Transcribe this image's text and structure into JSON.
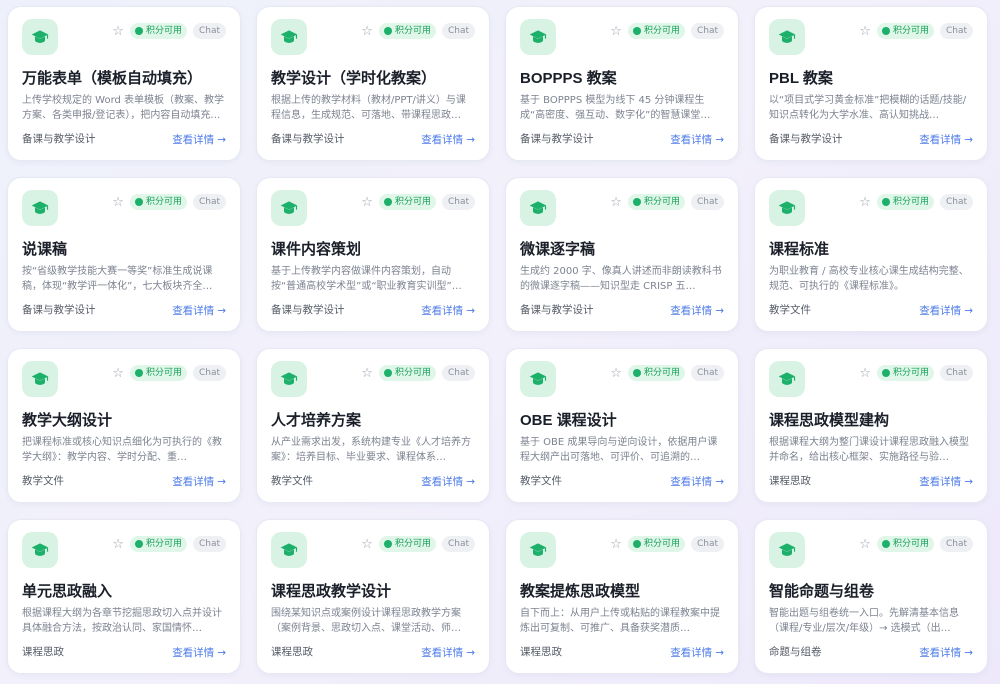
{
  "colors": {
    "icon_bg": "#d8f3e4",
    "icon_fg": "#1cb06a",
    "points_badge_bg": "#dff6e8",
    "points_badge_fg": "#17a05a",
    "link": "#4f7ce8"
  },
  "common": {
    "points_label": "积分可用",
    "chat_label": "Chat",
    "detail_label": "查看详情",
    "star_symbol": "☆",
    "arrow_symbol": "→",
    "icon_name": "graduation-cap-icon"
  },
  "cards": [
    {
      "title": "万能表单（模板自动填充）",
      "desc": "上传学校规定的 Word 表单模板（教案、教学方案、各类申报/登记表），把内容自动填充进去…",
      "category": "备课与教学设计"
    },
    {
      "title": "教学设计（学时化教案）",
      "desc": "根据上传的教学材料（教材/PPT/讲义）与课程信息，生成规范、可落地、带课程思政…",
      "category": "备课与教学设计"
    },
    {
      "title": "BOPPPS 教案",
      "desc": "基于 BOPPPS 模型为线下 45 分钟课程生成“高密度、强互动、数字化”的智慧课堂…",
      "category": "备课与教学设计"
    },
    {
      "title": "PBL 教案",
      "desc": "以“项目式学习黄金标准”把模糊的话题/技能/知识点转化为大学水准、高认知挑战…",
      "category": "备课与教学设计"
    },
    {
      "title": "说课稿",
      "desc": "按“省级教学技能大赛一等奖”标准生成说课稿，体现“教学评一体化”，七大板块齐全…",
      "category": "备课与教学设计"
    },
    {
      "title": "课件内容策划",
      "desc": "基于上传教学内容做课件内容策划，自动按“普通高校学术型”或“职业教育实训型”…",
      "category": "备课与教学设计"
    },
    {
      "title": "微课逐字稿",
      "desc": "生成约 2000 字、像真人讲述而非朗读教科书的微课逐字稿——知识型走 CRISP 五…",
      "category": "备课与教学设计"
    },
    {
      "title": "课程标准",
      "desc": "为职业教育 / 高校专业核心课生成结构完整、规范、可执行的《课程标准》。",
      "category": "教学文件"
    },
    {
      "title": "教学大纲设计",
      "desc": "把课程标准或核心知识点细化为可执行的《教学大纲》：教学内容、学时分配、重…",
      "category": "教学文件"
    },
    {
      "title": "人才培养方案",
      "desc": "从产业需求出发，系统构建专业《人才培养方案》：培养目标、毕业要求、课程体系…",
      "category": "教学文件"
    },
    {
      "title": "OBE 课程设计",
      "desc": "基于 OBE 成果导向与逆向设计，依据用户课程大纲产出可落地、可评价、可追溯的…",
      "category": "教学文件"
    },
    {
      "title": "课程思政模型建构",
      "desc": "根据课程大纲为整门课设计课程思政融入模型并命名，给出核心框架、实施路径与验…",
      "category": "课程思政"
    },
    {
      "title": "单元思政融入",
      "desc": "根据课程大纲为各章节挖掘思政切入点并设计具体融合方法，按政治认同、家国情怀…",
      "category": "课程思政"
    },
    {
      "title": "课程思政教学设计",
      "desc": "围绕某知识点或案例设计课程思政教学方案（案例背景、思政切入点、课堂活动、师…",
      "category": "课程思政"
    },
    {
      "title": "教案提炼思政模型",
      "desc": "自下而上：从用户上传或粘贴的课程教案中提炼出可复制、可推广、具备获奖潜质…",
      "category": "课程思政"
    },
    {
      "title": "智能命题与组卷",
      "desc": "智能出题与组卷统一入口。先解清基本信息（课程/专业/层次/年级）→ 选模式（出…",
      "category": "命题与组卷"
    }
  ]
}
